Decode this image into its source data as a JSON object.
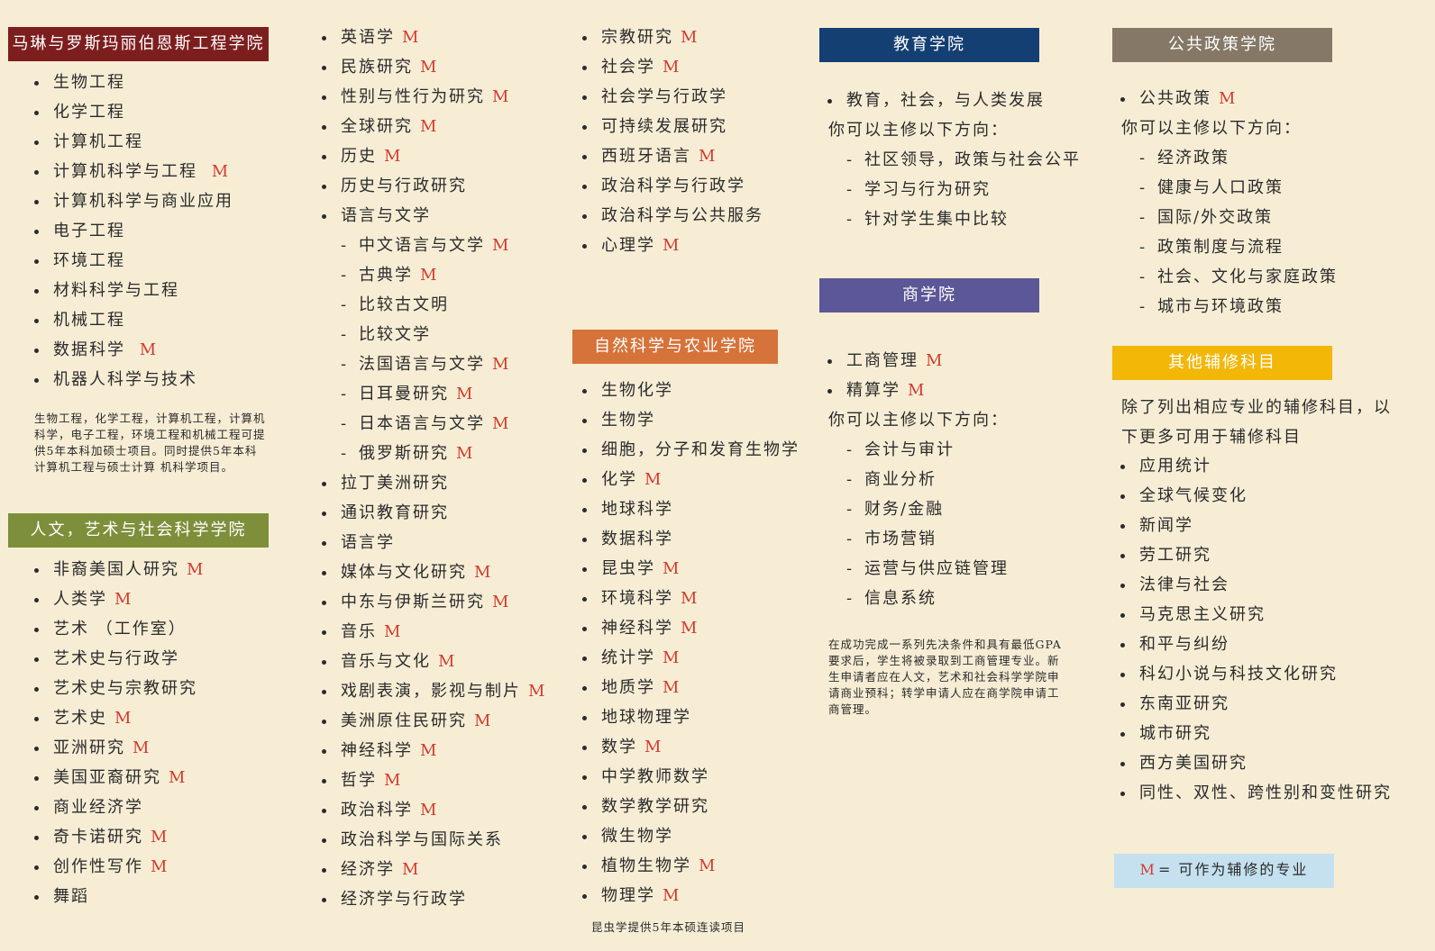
{
  "engineering": {
    "title": "马琳与罗斯玛丽伯恩斯工程学院",
    "items": [
      {
        "t": "生物工程",
        "m": false
      },
      {
        "t": "化学工程",
        "m": false
      },
      {
        "t": "计算机工程",
        "m": false
      },
      {
        "t": "计算机科学与工程 ",
        "m": true
      },
      {
        "t": "计算机科学与商业应用",
        "m": false
      },
      {
        "t": "电子工程",
        "m": false
      },
      {
        "t": "环境工程",
        "m": false
      },
      {
        "t": "材料科学与工程",
        "m": false
      },
      {
        "t": "机械工程",
        "m": false
      },
      {
        "t": "数据科学 ",
        "m": true
      },
      {
        "t": "机器人科学与技术",
        "m": false
      }
    ],
    "note": "生物工程，化学工程，计算机工程，计算机科学，电子工程，环境工程和机械工程可提供5年本科加硕士项目。同时提供5年本科计算机工程与硕士计算 机科学项目。"
  },
  "humanities": {
    "title": "人文，艺术与社会科学学院",
    "items": [
      {
        "t": "非裔美国人研究",
        "m": true,
        "l": 0
      },
      {
        "t": "人类学",
        "m": true,
        "l": 0
      },
      {
        "t": "艺术 （工作室）",
        "m": false,
        "l": 0
      },
      {
        "t": "艺术史与行政学",
        "m": false,
        "l": 0
      },
      {
        "t": "艺术史与宗教研究",
        "m": false,
        "l": 0
      },
      {
        "t": "艺术史",
        "m": true,
        "l": 0
      },
      {
        "t": "亚洲研究",
        "m": true,
        "l": 0
      },
      {
        "t": "美国亚裔研究",
        "m": true,
        "l": 0
      },
      {
        "t": "商业经济学",
        "m": false,
        "l": 0
      },
      {
        "t": "奇卡诺研究",
        "m": true,
        "l": 0
      },
      {
        "t": "创作性写作",
        "m": true,
        "l": 0
      },
      {
        "t": "舞蹈",
        "m": false,
        "l": 0
      }
    ],
    "items_col2": [
      {
        "t": "英语学",
        "m": true,
        "l": 0
      },
      {
        "t": "民族研究",
        "m": true,
        "l": 0
      },
      {
        "t": "性别与性行为研究",
        "m": true,
        "l": 0
      },
      {
        "t": "全球研究",
        "m": true,
        "l": 0
      },
      {
        "t": "历史",
        "m": true,
        "l": 0
      },
      {
        "t": "历史与行政研究",
        "m": false,
        "l": 0
      },
      {
        "t": "语言与文学",
        "m": false,
        "l": 0
      },
      {
        "t": "中文语言与文学",
        "m": true,
        "l": 1
      },
      {
        "t": "古典学",
        "m": true,
        "l": 1
      },
      {
        "t": "比较古文明",
        "m": false,
        "l": 1
      },
      {
        "t": "比较文学",
        "m": false,
        "l": 1
      },
      {
        "t": "法国语言与文学",
        "m": true,
        "l": 1
      },
      {
        "t": "日耳曼研究",
        "m": true,
        "l": 1
      },
      {
        "t": "日本语言与文学",
        "m": true,
        "l": 1
      },
      {
        "t": "俄罗斯研究",
        "m": true,
        "l": 1
      },
      {
        "t": "拉丁美洲研究",
        "m": false,
        "l": 0
      },
      {
        "t": "通识教育研究",
        "m": false,
        "l": 0
      },
      {
        "t": "语言学",
        "m": false,
        "l": 0
      },
      {
        "t": "媒体与文化研究",
        "m": true,
        "l": 0
      },
      {
        "t": "中东与伊斯兰研究",
        "m": true,
        "l": 0
      },
      {
        "t": "音乐",
        "m": true,
        "l": 0
      },
      {
        "t": "音乐与文化",
        "m": true,
        "l": 0
      },
      {
        "t": "戏剧表演，影视与制片",
        "m": true,
        "l": 0
      },
      {
        "t": "美洲原住民研究",
        "m": true,
        "l": 0
      },
      {
        "t": "神经科学",
        "m": true,
        "l": 0
      },
      {
        "t": "哲学",
        "m": true,
        "l": 0
      },
      {
        "t": "政治科学",
        "m": true,
        "l": 0
      },
      {
        "t": "政治科学与国际关系",
        "m": false,
        "l": 0
      },
      {
        "t": "经济学",
        "m": true,
        "l": 0
      },
      {
        "t": "经济学与行政学",
        "m": false,
        "l": 0
      }
    ],
    "items_col3": [
      {
        "t": "宗教研究",
        "m": true
      },
      {
        "t": "社会学",
        "m": true
      },
      {
        "t": "社会学与行政学",
        "m": false
      },
      {
        "t": "可持续发展研究",
        "m": false
      },
      {
        "t": "西班牙语言",
        "m": true
      },
      {
        "t": "政治科学与行政学",
        "m": false
      },
      {
        "t": "政治科学与公共服务",
        "m": false
      },
      {
        "t": "心理学",
        "m": true
      }
    ]
  },
  "natural": {
    "title": "自然科学与农业学院",
    "items": [
      {
        "t": "生物化学",
        "m": false
      },
      {
        "t": "生物学",
        "m": false
      },
      {
        "t": "细胞，分子和发育生物学",
        "m": false
      },
      {
        "t": "化学",
        "m": true
      },
      {
        "t": "地球科学",
        "m": false
      },
      {
        "t": "数据科学",
        "m": false
      },
      {
        "t": "昆虫学",
        "m": true
      },
      {
        "t": "环境科学",
        "m": true
      },
      {
        "t": "神经科学",
        "m": true
      },
      {
        "t": "统计学",
        "m": true
      },
      {
        "t": "地质学",
        "m": true
      },
      {
        "t": "地球物理学",
        "m": false
      },
      {
        "t": "数学",
        "m": true
      },
      {
        "t": "中学教师数学",
        "m": false
      },
      {
        "t": "数学教学研究",
        "m": false
      },
      {
        "t": "微生物学",
        "m": false
      },
      {
        "t": "植物生物学",
        "m": true
      },
      {
        "t": "物理学",
        "m": true
      }
    ],
    "note": "昆虫学提供5年本硕连读项目"
  },
  "education": {
    "title": "教育学院",
    "item": "教育，社会，与人类发展",
    "major_intro": "你可以主修以下方向：",
    "subs": [
      "社区领导，政策与社会公平",
      "学习与行为研究",
      "针对学生集中比较"
    ]
  },
  "business": {
    "title": "商学院",
    "items": [
      {
        "t": "工商管理",
        "m": true
      },
      {
        "t": "精算学",
        "m": true
      }
    ],
    "major_intro": "你可以主修以下方向：",
    "subs": [
      "会计与审计",
      "商业分析",
      "财务/金融",
      "市场营销",
      "运营与供应链管理",
      "信息系统"
    ],
    "note": "在成功完成一系列先决条件和具有最低GPA要求后，学生将被录取到工商管理专业。新生申请者应在人文，艺术和社会科学学院申请商业预科；转学申请人应在商学院申请工商管理。"
  },
  "policy": {
    "title": "公共政策学院",
    "items": [
      {
        "t": "公共政策",
        "m": true
      }
    ],
    "major_intro": "你可以主修以下方向：",
    "subs": [
      "经济政策",
      "健康与人口政策",
      "国际/外交政策",
      "政策制度与流程",
      "社会、文化与家庭政策",
      "城市与环境政策"
    ]
  },
  "minors": {
    "title": "其他辅修科目",
    "intro": "除了列出相应专业的辅修科目，以下更多可用于辅修科目",
    "items": [
      "应用统计",
      "全球气候变化",
      "新闻学",
      "劳工研究",
      "法律与社会",
      "马克思主义研究",
      "和平与纠纷",
      "科幻小说与科技文化研究",
      "东南亚研究",
      "城市研究",
      "西方美国研究",
      "同性、双性、跨性别和变性研究"
    ]
  },
  "legend": {
    "mark": "M",
    "text": "= 可作为辅修的专业"
  },
  "marker": "M",
  "colors": {
    "engineering": "#7d1e1e",
    "humanities": "#7d8f3a",
    "natural": "#d6733a",
    "education": "#143f73",
    "business": "#5c5796",
    "policy": "#857866",
    "minors": "#f2b707",
    "legend": "#c5e1ef",
    "mark": "#d33a2c"
  }
}
